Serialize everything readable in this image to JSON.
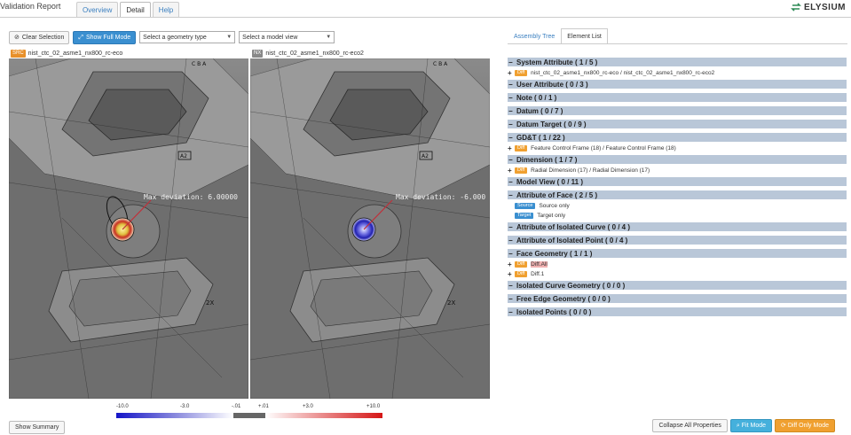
{
  "app": {
    "title": "Validation Report",
    "brand": "ELYSIUM"
  },
  "tabs": [
    {
      "label": "Overview",
      "active": false
    },
    {
      "label": "Detail",
      "active": true
    },
    {
      "label": "Help",
      "active": false
    }
  ],
  "toolbar": {
    "clear_selection": "Clear Selection",
    "show_full_mode": "Show Full Mode",
    "geometry_select": "Select a geometry type",
    "view_select": "Select a model view"
  },
  "viewports": {
    "left": {
      "tag": "SRC",
      "name": "nist_ctc_02_asme1_nx800_rc-eco",
      "max_deviation": "Max deviation: 6.00000"
    },
    "right": {
      "tag": "NX",
      "name": "nist_ctc_02_asme1_nx800_rc-eco2",
      "max_deviation": "Max deviation: -6.000"
    }
  },
  "color_scale": {
    "labels": [
      "-10.0",
      "-3.0",
      "-.01",
      "+.01",
      "+3.0",
      "+10.0"
    ],
    "colors": {
      "negative": "#1515c8",
      "positive": "#d51616",
      "neutral": "#666666"
    }
  },
  "show_summary": "Show Summary",
  "panel_tabs": [
    {
      "label": "Assembly Tree",
      "active": false
    },
    {
      "label": "Element List",
      "active": true
    }
  ],
  "tree": {
    "system_attribute": {
      "label": "System Attribute ( 1 / 5 )",
      "items": [
        {
          "badge": "Diff",
          "text": "nist_ctc_02_asme1_nx800_rc-eco / nist_ctc_02_asme1_nx800_rc-eco2"
        }
      ]
    },
    "user_attribute": {
      "label": "User Attribute ( 0 / 3 )"
    },
    "note": {
      "label": "Note ( 0 / 1 )"
    },
    "datum": {
      "label": "Datum ( 0 / 7 )"
    },
    "datum_target": {
      "label": "Datum Target ( 0 / 9 )"
    },
    "gdt": {
      "label": "GD&T ( 1 / 22 )",
      "items": [
        {
          "badge": "Diff",
          "text": "Feature Control Frame (18) / Feature Control Frame (18)"
        }
      ]
    },
    "dimension": {
      "label": "Dimension ( 1 / 7 )",
      "items": [
        {
          "badge": "Diff",
          "text": "Radial Dimension (17) / Radial Dimension (17)"
        }
      ]
    },
    "model_view": {
      "label": "Model View ( 0 / 11 )"
    },
    "attribute_of_face": {
      "label": "Attribute of Face ( 2 / 5 )",
      "items": [
        {
          "badge": "Source",
          "text": "Source only"
        },
        {
          "badge": "Target",
          "text": "Target only"
        }
      ]
    },
    "isolated_curve": {
      "label": "Attribute of Isolated Curve ( 0 / 4 )"
    },
    "isolated_point": {
      "label": "Attribute of Isolated Point ( 0 / 4 )"
    },
    "face_geometry": {
      "label": "Face Geometry ( 1 / 1 )",
      "items": [
        {
          "badge": "Diff",
          "text": "Diff.All"
        },
        {
          "badge": "Diff",
          "text": "Diff.1"
        }
      ]
    },
    "isolated_curve_geometry": {
      "label": "Isolated Curve Geometry ( 0 / 0 )"
    },
    "free_edge_geometry": {
      "label": "Free Edge Geometry ( 0 / 0 )"
    },
    "isolated_points": {
      "label": "Isolated Points ( 0 / 0 )"
    }
  },
  "buttons": {
    "collapse_all": "Collapse All Properties",
    "fit_mode": "Fit Mode",
    "diff_only_mode": "Diff Only Mode"
  },
  "model_labels": {
    "a2": "A2",
    "two_x": "2X",
    "cba": "C B A"
  }
}
